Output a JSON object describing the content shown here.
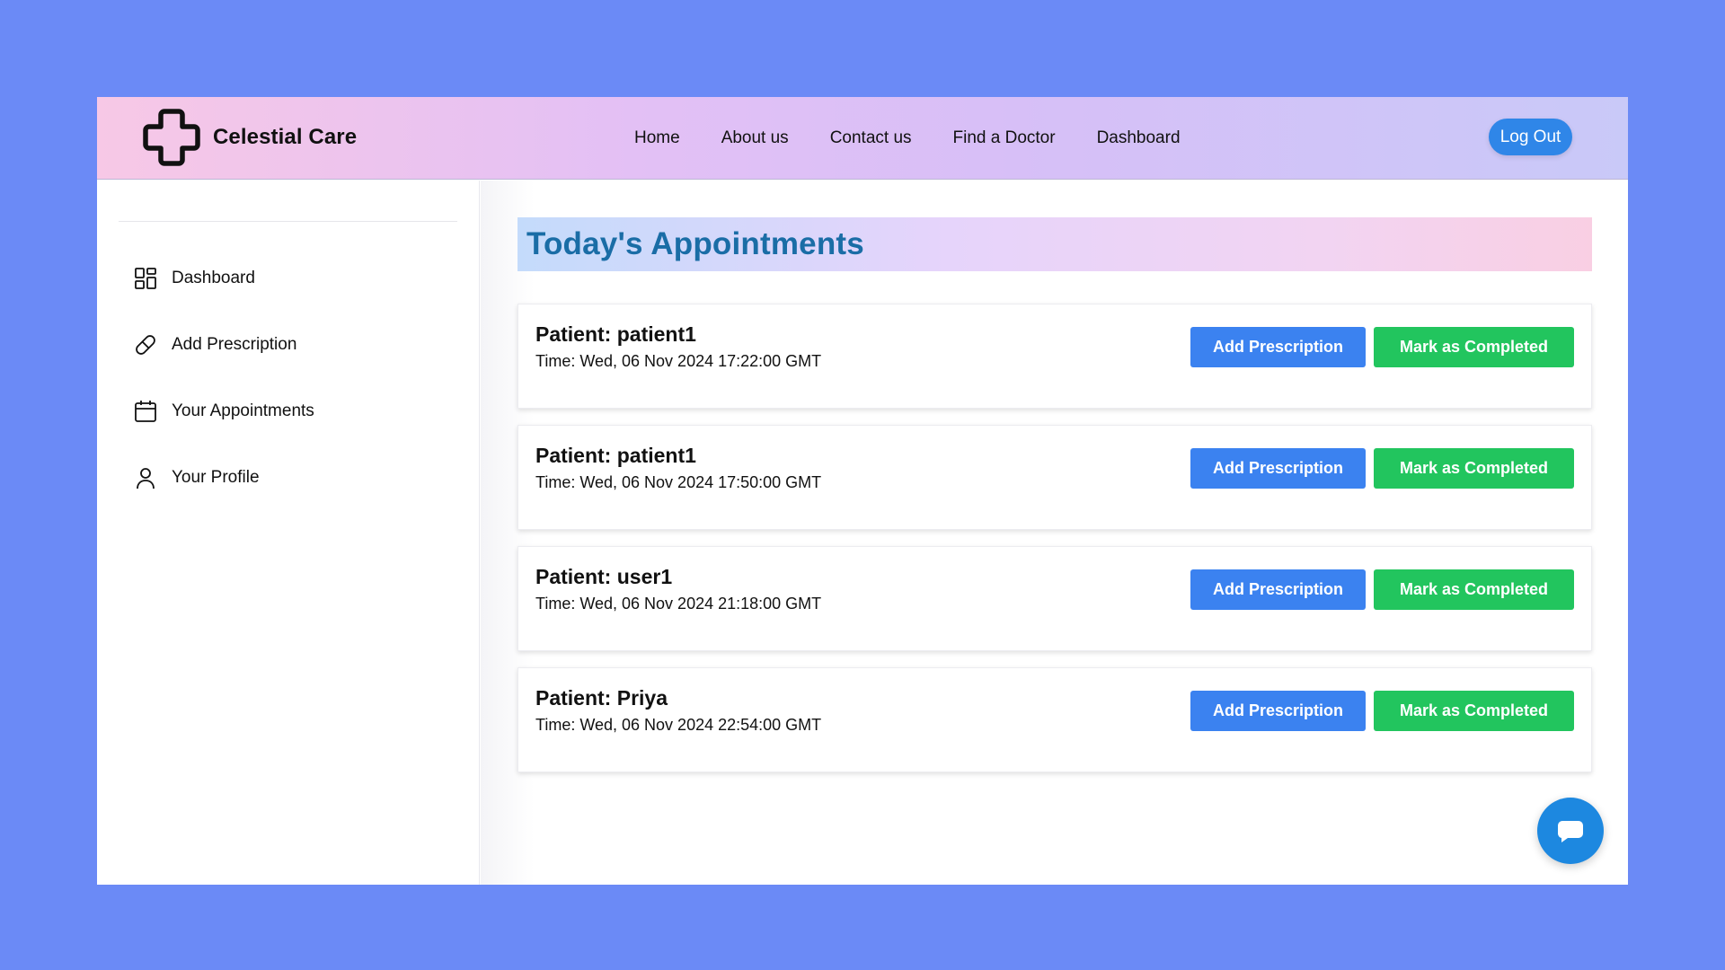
{
  "brand": {
    "name": "Celestial Care",
    "icon": "medical-cross-icon"
  },
  "nav": {
    "links": [
      "Home",
      "About us",
      "Contact us",
      "Find a Doctor",
      "Dashboard"
    ],
    "logout_label": "Log Out"
  },
  "sidebar": {
    "items": [
      {
        "label": "Dashboard",
        "icon": "dashboard-grid-icon"
      },
      {
        "label": "Add Prescription",
        "icon": "pill-icon"
      },
      {
        "label": "Your Appointments",
        "icon": "calendar-icon"
      },
      {
        "label": "Your Profile",
        "icon": "user-icon"
      }
    ]
  },
  "main": {
    "title": "Today's Appointments",
    "appointments": [
      {
        "patient": "Patient: patient1",
        "time": "Time: Wed, 06 Nov 2024 17:22:00 GMT",
        "prescription_label": "Add Prescription",
        "complete_label": "Mark as Completed"
      },
      {
        "patient": "Patient: patient1",
        "time": "Time: Wed, 06 Nov 2024 17:50:00 GMT",
        "prescription_label": "Add Prescription",
        "complete_label": "Mark as Completed"
      },
      {
        "patient": "Patient: user1",
        "time": "Time: Wed, 06 Nov 2024 21:18:00 GMT",
        "prescription_label": "Add Prescription",
        "complete_label": "Mark as Completed"
      },
      {
        "patient": "Patient: Priya",
        "time": "Time: Wed, 06 Nov 2024 22:54:00 GMT",
        "prescription_label": "Add Prescription",
        "complete_label": "Mark as Completed"
      }
    ]
  },
  "chat": {
    "icon": "chat-bubble-icon"
  },
  "colors": {
    "background": "#6b8af6",
    "title_text": "#1a6da6",
    "primary_button": "#3b82f0",
    "success_button": "#22c55e",
    "logout_button": "#2f86e8",
    "chat_button": "#1d88e0"
  }
}
